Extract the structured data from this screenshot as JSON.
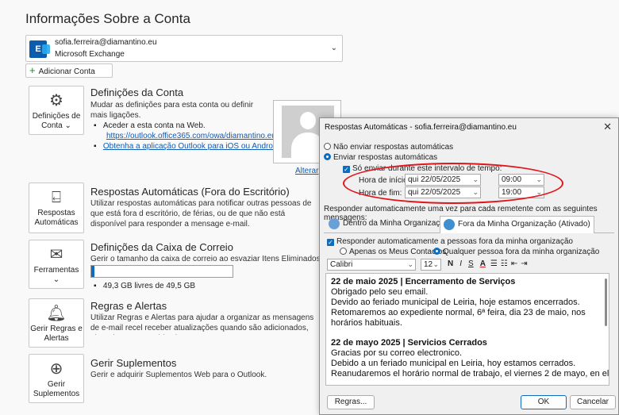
{
  "page_title": "Informações Sobre a Conta",
  "account": {
    "email": "sofia.ferreira@diamantino.eu",
    "type": "Microsoft Exchange",
    "icon": "exchange-icon"
  },
  "add_account": "Adicionar Conta",
  "settings": {
    "tile": "Definições de Conta",
    "heading": "Definições da Conta",
    "desc": "Mudar as definições para esta conta ou definir mais ligações.",
    "bullet1": "Aceder a esta conta na Web.",
    "link1": "https://outlook.office365.com/owa/diamantino.eu/",
    "link2": "Obtenha a aplicação Outlook para iOS ou Android.",
    "photo_action": "Alterar"
  },
  "auto_reply": {
    "tile": "Respostas Automáticas",
    "heading": "Respostas Automáticas (Fora do Escritório)",
    "desc": "Utilizar respostas automáticas para notificar outras pessoas de que está fora d escritório, de férias, ou de que não está disponível para responder a mensage e-mail."
  },
  "mailbox": {
    "tile": "Ferramentas",
    "heading": "Definições da Caixa de Correio",
    "desc": "Gerir o tamanho da caixa de correio ao esvaziar Itens Eliminados e ao arquiva",
    "usage_text": "49,3 GB livres de 49,5 GB",
    "used_fraction": 0.004
  },
  "rules": {
    "tile": "Gerir Regras e Alertas",
    "heading": "Regras e Alertas",
    "desc": "Utilizar Regras e Alertas para ajudar a organizar as mensagens de e-mail recel receber atualizações quando são adicionados, alterados ou removidos itens."
  },
  "addins": {
    "tile": "Gerir Suplementos",
    "heading": "Gerir Suplementos",
    "desc": "Gerir e adquirir Suplementos Web para o Outlook."
  },
  "dialog": {
    "title": "Respostas Automáticas - sofia.ferreira@diamantino.eu",
    "opt_off": "Não enviar respostas automáticas",
    "opt_on": "Enviar respostas automáticas",
    "only_range": "Só enviar durante este intervalo de tempo:",
    "start_label": "Hora de início:",
    "start_date": "qui 22/05/2025",
    "start_time": "09:00",
    "end_label": "Hora de fim:",
    "end_date": "qui 22/05/2025",
    "end_time": "19:00",
    "reply_note": "Responder automaticamente uma vez para cada remetente com as seguintes mensagens:",
    "tab_inside": "Dentro da Minha Organização",
    "tab_outside": "Fora da Minha Organização (Ativado)",
    "outside_check": "Responder automaticamente a pessoas fora da minha organização",
    "contacts_only": "Apenas os Meus Contactos",
    "anyone": "Qualquer pessoa fora da minha organização",
    "font": "Calibri",
    "size": "12",
    "fmt_n": "N",
    "fmt_i": "I",
    "fmt_s": "S",
    "fmt_a": "A",
    "msg": [
      "22 de maio 2025 | Encerramento de Serviços",
      "Obrigado pelo seu email.",
      "Devido ao feriado municipal de Leiria, hoje estamos encerrados.",
      "Retomaremos ao expediente normal, 6ª feira, dia 23 de maio, nos",
      "horários habituais.",
      "22 de mayo 2025 | Servicios Cerrados",
      "Gracias por su correo electronico.",
      "Debido a un feriado municipal en Leiria, hoy estamos cerrados.",
      "Reanudaremos el horário normal de trabajo, el viernes 2 de mayo, en el"
    ],
    "rules_btn": "Regras...",
    "ok_btn": "OK",
    "cancel_btn": "Cancelar"
  },
  "colors": {
    "accent": "#0f6cbd",
    "highlight": "#e0151d"
  }
}
